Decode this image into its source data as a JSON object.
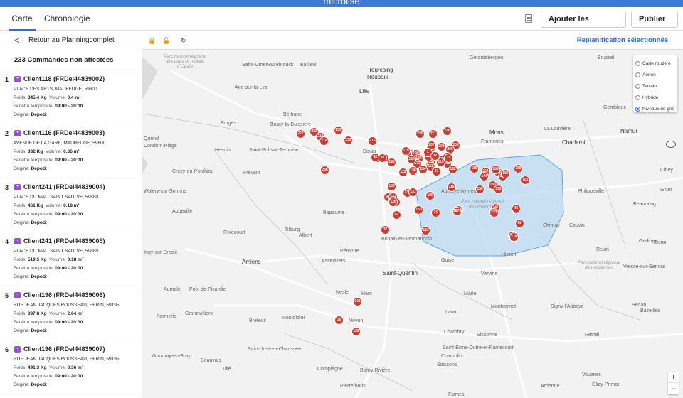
{
  "topbar": {
    "brand": "microlise",
    "left_text": ""
  },
  "tabs": [
    {
      "label": "Carte"
    },
    {
      "label": "Chronologie"
    }
  ],
  "toolbar": {
    "add_orders": "Ajouter les commandes",
    "publish": "Publier",
    "chevron": "∨",
    "doc_icon": "document-icon"
  },
  "sidebar": {
    "back": "Retour au Planningcomplet",
    "back_arrow": "<",
    "count": "233 Commandes non affectées",
    "orders": [
      {
        "num": "1",
        "title": "Client118 (FRDel44839002)",
        "address": "PLACE DES ARTS, MAUBEUGE, 59600",
        "weight_label": "Poids:",
        "weight": "345.4 Kg",
        "volume_label": "Volume:",
        "volume": "0.4 m³",
        "window_label": "Fenêtre temporelle:",
        "window": "09:00 - 20:00",
        "origin_label": "Origine:",
        "origin": "Depot2"
      },
      {
        "num": "2",
        "title": "Client116 (FRDel44839003)",
        "address": "AVENUE DE LA GARE, MAUBEUGE, 59600",
        "weight_label": "Poids:",
        "weight": "832 Kg",
        "volume_label": "Volume:",
        "volume": "0.36 m³",
        "window_label": "Fenêtre temporelle:",
        "window": "09:00 - 20:00",
        "origin_label": "Origine:",
        "origin": "Depot2"
      },
      {
        "num": "3",
        "title": "Client241 (FRDel44839004)",
        "address": "PLACE DU MAI , SAINT SAULVE, 59880",
        "weight_label": "Poids:",
        "weight": "461 Kg",
        "volume_label": "Volume:",
        "volume": "0.18 m³",
        "window_label": "Fenêtre temporelle:",
        "window": "09:00 - 20:00",
        "origin_label": "Origine:",
        "origin": "Depot2"
      },
      {
        "num": "4",
        "title": "Client241 (FRDel44839005)",
        "address": "PLACE DU MAI , SAINT SAULVE, 59880",
        "weight_label": "Poids:",
        "weight": "519.5 Kg",
        "volume_label": "Volume:",
        "volume": "0.18 m³",
        "window_label": "Fenêtre temporelle:",
        "window": "09:00 - 20:00",
        "origin_label": "Origine:",
        "origin": "Depot2"
      },
      {
        "num": "5",
        "title": "Client196 (FRDel44839006)",
        "address": "RUE JEAN JACQUES ROUSSEAU, HERIN, 59195",
        "weight_label": "Poids:",
        "weight": "397.8 Kg",
        "volume_label": "Volume:",
        "volume": "2.64 m³",
        "window_label": "Fenêtre temporelle:",
        "window": "09:00 - 20:00",
        "origin_label": "Origine:",
        "origin": "Depot2"
      },
      {
        "num": "6",
        "title": "Client196 (FRDel44839007)",
        "address": "RUE JEAN JACQUES ROUSSEAU, HERIN, 59195",
        "weight_label": "Poids:",
        "weight": "491.3 Kg",
        "volume_label": "Volume:",
        "volume": "0.36 m³",
        "window_label": "Fenêtre temporelle:",
        "window": "09:00 - 20:00",
        "origin_label": "Origine:",
        "origin": "Depot2"
      }
    ]
  },
  "maptools": {
    "lock_icon": "lock-icon",
    "unlock_icon": "unlock-icon",
    "refresh_icon": "refresh-icon",
    "replan": "Replanification sélectionnée"
  },
  "map": {
    "layers": [
      {
        "label": "Carte routière",
        "selected": false
      },
      {
        "label": "Aérien",
        "selected": false
      },
      {
        "label": "Terrain",
        "selected": false
      },
      {
        "label": "Hybride",
        "selected": false
      },
      {
        "label": "Niveaux de gris",
        "selected": true
      }
    ],
    "zoom_in": "+",
    "zoom_out": "–",
    "places": [
      {
        "name": "Saint-Omer"
      },
      {
        "name": "Hazebrouck"
      },
      {
        "name": "Bailleul"
      },
      {
        "name": "Tourcoing"
      },
      {
        "name": "Roubaix"
      },
      {
        "name": "Lille"
      },
      {
        "name": "Gerardsbergen"
      },
      {
        "name": "Brussel"
      },
      {
        "name": "Aire-sur-la-Lys"
      },
      {
        "name": "Béthune"
      },
      {
        "name": "Fruges"
      },
      {
        "name": "Bruay-la-Buissière"
      },
      {
        "name": "Hesdin"
      },
      {
        "name": "Saint-Pol-sur-Ternoise"
      },
      {
        "name": "Douai"
      },
      {
        "name": "Mons"
      },
      {
        "name": "La Louvière"
      },
      {
        "name": "Charleroi"
      },
      {
        "name": "Namur"
      },
      {
        "name": "Gembloux"
      },
      {
        "name": "Frameries"
      },
      {
        "name": "Crécy-en-Ponthieu"
      },
      {
        "name": "Frévent"
      },
      {
        "name": "Abbeville"
      },
      {
        "name": "Bapaume"
      },
      {
        "name": "Albert"
      },
      {
        "name": "Flixecourt"
      },
      {
        "name": "Philippeville"
      },
      {
        "name": "Ciney"
      },
      {
        "name": "Couvin"
      },
      {
        "name": "Givet"
      },
      {
        "name": "Beauraing"
      },
      {
        "name": "Chimay"
      },
      {
        "name": "Aulnoye-Aymeries"
      },
      {
        "name": "Bohain-en-Vermandois"
      },
      {
        "name": "Hirson"
      },
      {
        "name": "Guise"
      },
      {
        "name": "Amiens"
      },
      {
        "name": "Péronne"
      },
      {
        "name": "Assevillers"
      },
      {
        "name": "Saint-Quentin"
      },
      {
        "name": "Vervins"
      },
      {
        "name": "Rocroi"
      },
      {
        "name": "Revin"
      },
      {
        "name": "Gedinne"
      },
      {
        "name": "Vresse-sur-Semois"
      },
      {
        "name": "Aumale"
      },
      {
        "name": "Poix-de-Picardie"
      },
      {
        "name": "Nesle"
      },
      {
        "name": "Ham"
      },
      {
        "name": "Marle"
      },
      {
        "name": "Montcornet"
      },
      {
        "name": "Signy-l'Abbaye"
      },
      {
        "name": "Sedan"
      },
      {
        "name": "Bazeilles"
      },
      {
        "name": "Formerie"
      },
      {
        "name": "Grandvilliers"
      },
      {
        "name": "Breteuil"
      },
      {
        "name": "Montdidier"
      },
      {
        "name": "Noyon"
      },
      {
        "name": "Laon"
      },
      {
        "name": "Chambry"
      },
      {
        "name": "Sissonne"
      },
      {
        "name": "Saint-Erme-Outre-et-Ramecourt"
      },
      {
        "name": "Rethel"
      },
      {
        "name": "Champlin"
      },
      {
        "name": "Saint-Just-en-Chaussée"
      },
      {
        "name": "Gournay-en-Bray"
      },
      {
        "name": "Beauvais"
      },
      {
        "name": "Tillé"
      },
      {
        "name": "Compiègne"
      },
      {
        "name": "Berny-Rivière"
      },
      {
        "name": "Soissons"
      },
      {
        "name": "Pierrefonds"
      },
      {
        "name": "Fismes"
      },
      {
        "name": "Vouziers"
      },
      {
        "name": "Olizy-Primat"
      },
      {
        "name": "Quend"
      },
      {
        "name": "Condom-Plage"
      },
      {
        "name": "Walery-sur-Somme"
      },
      {
        "name": "Ingy-sur-Bresle"
      },
      {
        "name": "Parc naturel régional des caps et marais d'Opale"
      },
      {
        "name": "Parc naturel régional de l'Avesnois"
      },
      {
        "name": "Parc naturel régional des Ardennes"
      },
      {
        "name": "Tilburg"
      },
      {
        "name": "Ardenne"
      }
    ],
    "pins": [
      "227",
      "232",
      "218",
      "216",
      "233",
      "213",
      "215",
      "221",
      "239",
      "230",
      "208",
      "219",
      "207",
      "204",
      "206",
      "171",
      "175",
      "199",
      "194",
      "173",
      "160",
      "167",
      "197",
      "149",
      "165",
      "142",
      "166",
      "193",
      "4",
      "2",
      "122",
      "138",
      "154",
      "158",
      "18",
      "19",
      "185",
      "101",
      "144",
      "152",
      "148",
      "188",
      "162",
      "181",
      "236",
      "105",
      "137",
      "131",
      "164",
      "177",
      "128",
      "147",
      "150",
      "180",
      "126",
      "140",
      "156",
      "186",
      "176",
      "174",
      "189",
      "183",
      "141",
      "127",
      "45",
      "82",
      "37",
      "21",
      "133",
      "143",
      "16",
      "195",
      "87",
      "115",
      "151",
      "1",
      "42",
      "10",
      "12",
      "17",
      "116",
      "192",
      "167b"
    ]
  }
}
